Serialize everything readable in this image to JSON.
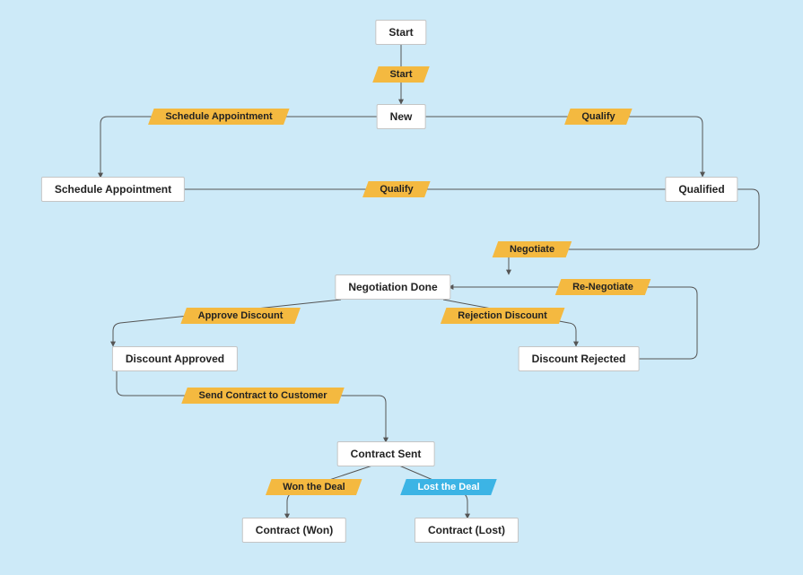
{
  "nodes": {
    "start": "Start",
    "new": "New",
    "schedule_appointment": "Schedule Appointment",
    "qualified": "Qualified",
    "negotiation_done": "Negotiation Done",
    "discount_approved": "Discount Approved",
    "discount_rejected": "Discount Rejected",
    "contract_sent": "Contract Sent",
    "contract_won": "Contract (Won)",
    "contract_lost": "Contract (Lost)"
  },
  "actions": {
    "start": "Start",
    "schedule_appointment": "Schedule Appointment",
    "qualify_top": "Qualify",
    "qualify_mid": "Qualify",
    "negotiate": "Negotiate",
    "re_negotiate": "Re-Negotiate",
    "approve_discount": "Approve Discount",
    "rejection_discount": "Rejection Discount",
    "send_contract": "Send Contract to Customer",
    "won_deal": "Won the Deal",
    "lost_deal": "Lost the Deal"
  },
  "chart_data": {
    "type": "flowchart",
    "states": [
      "Start",
      "New",
      "Schedule Appointment",
      "Qualified",
      "Negotiation Done",
      "Discount Approved",
      "Discount Rejected",
      "Contract Sent",
      "Contract (Won)",
      "Contract (Lost)"
    ],
    "transitions": [
      {
        "from": "Start",
        "to": "New",
        "label": "Start",
        "color": "gold"
      },
      {
        "from": "New",
        "to": "Schedule Appointment",
        "label": "Schedule Appointment",
        "color": "gold"
      },
      {
        "from": "New",
        "to": "Qualified",
        "label": "Qualify",
        "color": "gold"
      },
      {
        "from": "Schedule Appointment",
        "to": "Qualified",
        "label": "Qualify",
        "color": "gold"
      },
      {
        "from": "Qualified",
        "to": "Negotiation Done",
        "label": "Negotiate",
        "color": "gold"
      },
      {
        "from": "Negotiation Done",
        "to": "Discount Approved",
        "label": "Approve Discount",
        "color": "gold"
      },
      {
        "from": "Negotiation Done",
        "to": "Discount Rejected",
        "label": "Rejection Discount",
        "color": "gold"
      },
      {
        "from": "Discount Rejected",
        "to": "Negotiation Done",
        "label": "Re-Negotiate",
        "color": "gold"
      },
      {
        "from": "Discount Approved",
        "to": "Contract Sent",
        "label": "Send Contract to Customer",
        "color": "gold"
      },
      {
        "from": "Contract Sent",
        "to": "Contract (Won)",
        "label": "Won the Deal",
        "color": "gold"
      },
      {
        "from": "Contract Sent",
        "to": "Contract (Lost)",
        "label": "Lost the Deal",
        "color": "blue"
      }
    ]
  }
}
